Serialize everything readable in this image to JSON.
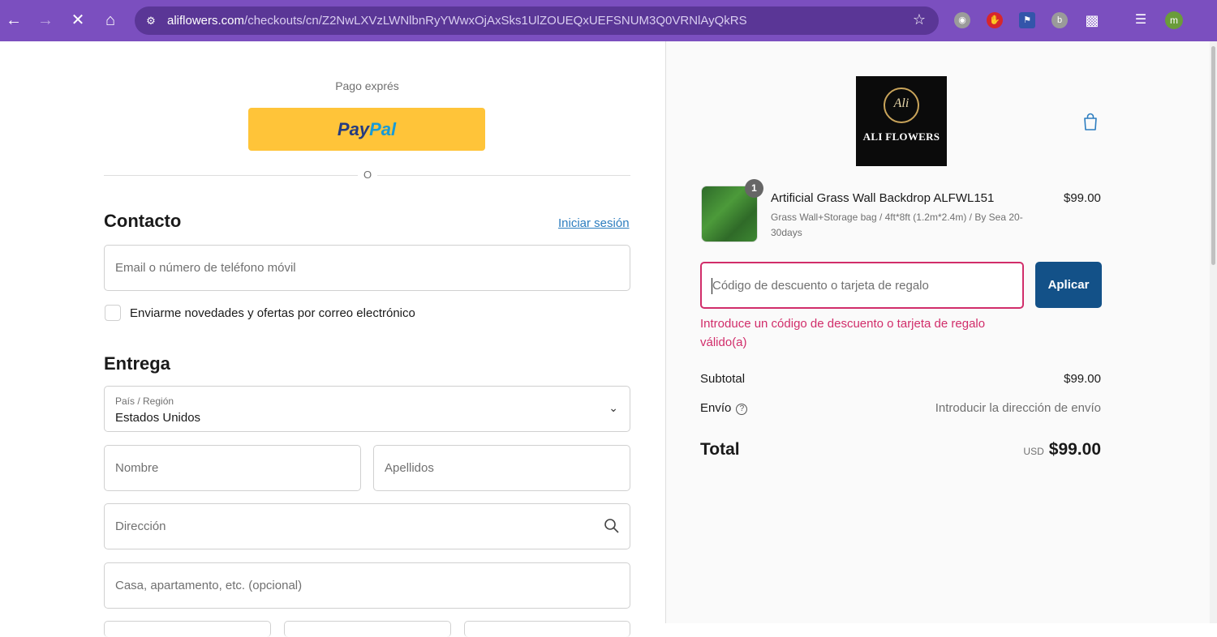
{
  "browser": {
    "url_host": "aliflowers.com",
    "url_path": "/checkouts/cn/Z2NwLXVzLWNlbnRyYWwxOjAxSks1UlZOUEQxUEFSNUM3Q0VRNlAyQkRS",
    "avatar_initial": "m",
    "icons": [
      "back-icon",
      "forward-icon",
      "close-icon",
      "home-icon",
      "site-settings-icon",
      "star-icon",
      "extensions-icon",
      "media-icon"
    ]
  },
  "checkout": {
    "express_label": "Pago exprés",
    "paypal_a": "Pay",
    "paypal_b": "Pal",
    "or_divider": "O",
    "contact": {
      "title": "Contacto",
      "login_link": "Iniciar sesión",
      "email_placeholder": "Email o número de teléfono móvil",
      "newsletter_label": "Enviarme novedades y ofertas por correo electrónico"
    },
    "delivery": {
      "title": "Entrega",
      "country_label": "País / Región",
      "country_value": "Estados Unidos",
      "first_name_placeholder": "Nombre",
      "last_name_placeholder": "Apellidos",
      "address_placeholder": "Dirección",
      "apartment_placeholder": "Casa, apartamento, etc. (opcional)"
    }
  },
  "summary": {
    "logo_top": "Ali",
    "logo_bottom": "ALI FLOWERS",
    "item": {
      "quantity": "1",
      "title": "Artificial Grass Wall Backdrop ALFWL151",
      "variant": "Grass Wall+Storage bag / 4ft*8ft (1.2m*2.4m) / By Sea 20-30days",
      "price": "$99.00"
    },
    "discount_placeholder": "Código de descuento o tarjeta de regalo",
    "apply_label": "Aplicar",
    "error_message": "Introduce un código de descuento o tarjeta de regalo válido(a)",
    "subtotal_label": "Subtotal",
    "subtotal_value": "$99.00",
    "shipping_label": "Envío",
    "shipping_value": "Introducir la dirección de envío",
    "total_label": "Total",
    "currency": "USD",
    "total_value": "$99.00"
  },
  "colors": {
    "browser_frame": "#7b4fbf",
    "paypal_button": "#ffc439",
    "apply_button": "#135188",
    "error": "#d12d6a",
    "link": "#2c7dbf"
  }
}
